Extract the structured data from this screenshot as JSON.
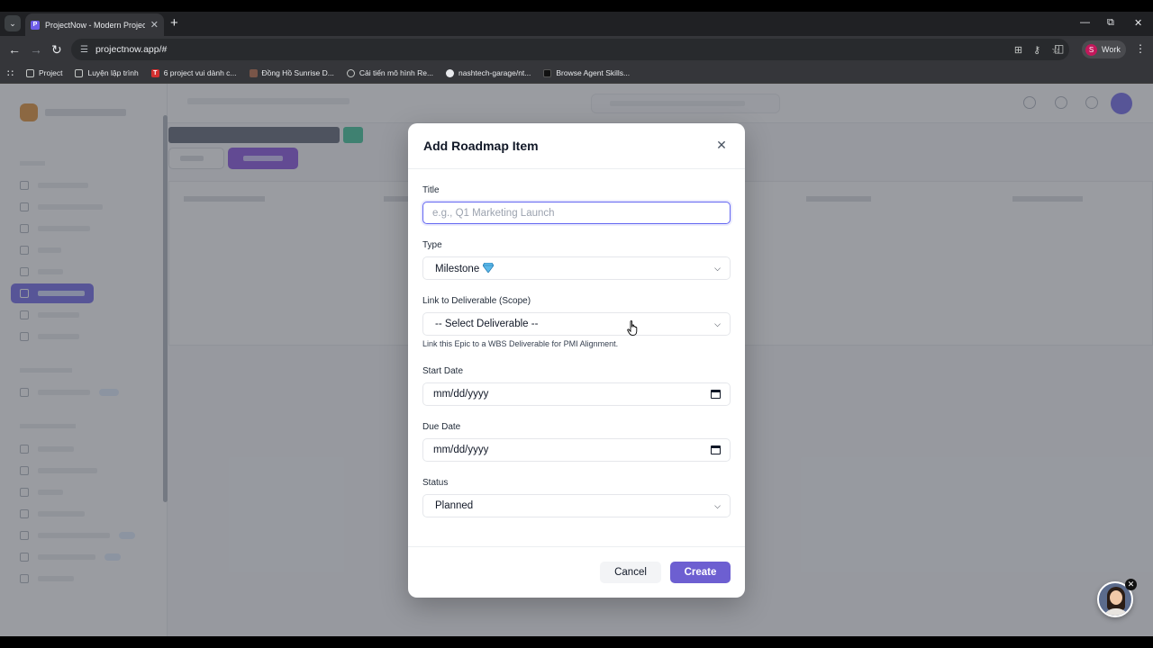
{
  "browser": {
    "tab_title": "ProjectNow - Modern Project M",
    "url": "projectnow.app/#",
    "profile_initial": "S",
    "profile_name": "Work",
    "bookmarks": [
      {
        "label": "Project",
        "icon": "folder-icon"
      },
      {
        "label": "Luyện lập trình",
        "icon": "folder-icon"
      },
      {
        "label": "6 project vui dành c...",
        "icon": "t-logo-icon"
      },
      {
        "label": "Đồng Hồ Sunrise D...",
        "icon": "clock-favicon-icon"
      },
      {
        "label": "Cải tiến mô hình Re...",
        "icon": "globe-icon"
      },
      {
        "label": "nashtech-garage/nt...",
        "icon": "github-icon"
      },
      {
        "label": "Browse Agent Skills...",
        "icon": "skills-favicon-icon"
      }
    ]
  },
  "modal": {
    "title": "Add Roadmap Item",
    "fields": {
      "title": {
        "label": "Title",
        "placeholder": "e.g., Q1 Marketing Launch",
        "value": ""
      },
      "type": {
        "label": "Type",
        "value": "Milestone"
      },
      "deliverable": {
        "label": "Link to Deliverable (Scope)",
        "value": "-- Select Deliverable --",
        "help": "Link this Epic to a WBS Deliverable for PMI Alignment."
      },
      "start_date": {
        "label": "Start Date",
        "value": "mm/dd/yyyy"
      },
      "due_date": {
        "label": "Due Date",
        "value": "mm/dd/yyyy"
      },
      "status": {
        "label": "Status",
        "value": "Planned"
      }
    },
    "buttons": {
      "cancel": "Cancel",
      "create": "Create"
    }
  },
  "colors": {
    "accent": "#6d5fd1",
    "focus_ring": "#6366f1"
  }
}
